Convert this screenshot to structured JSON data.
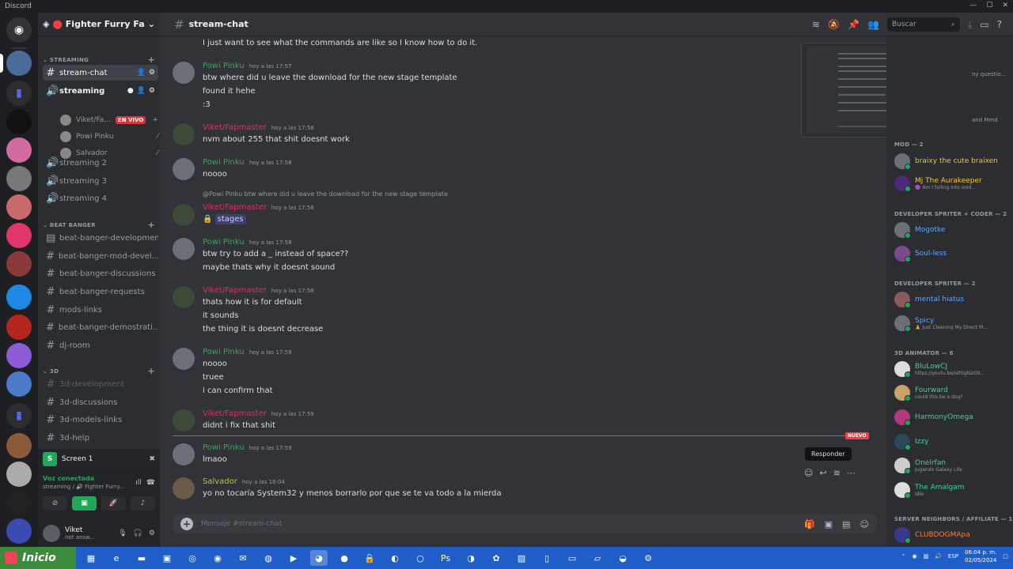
{
  "window": {
    "title": "Discord",
    "controls": [
      "—",
      "☐",
      "✕"
    ]
  },
  "server": {
    "name": "Fighter Furry Fac...",
    "chevron": "⌄"
  },
  "categories": {
    "streaming": "STREAMING",
    "beat_banger": "BEAT BANGER",
    "three_d": "3D"
  },
  "channels": {
    "stream_chat": "stream-chat",
    "streaming": "streaming",
    "streaming2": "streaming 2",
    "streaming3": "streaming 3",
    "streaming4": "streaming 4",
    "bb_dev": "beat-banger-development",
    "bb_mod": "beat-banger-mod-devel...",
    "bb_disc": "beat-banger-discussions",
    "bb_req": "beat-banger-requests",
    "mods_links": "mods-links",
    "bb_demo": "beat-banger-demostrati...",
    "dj_room": "dj-room",
    "td_dev": "3d-development",
    "td_disc": "3d-discussions",
    "td_models": "3d-models-links",
    "td_help": "3d-help"
  },
  "voice_users": [
    {
      "name": "Viket/Fa...",
      "badge": "EN VIVO"
    },
    {
      "name": "Powi Pinku"
    },
    {
      "name": "Salvador"
    }
  ],
  "screen_share": {
    "label": "Screen 1",
    "icon": "S"
  },
  "voice": {
    "status": "Voz conectada",
    "location": "streaming / 🔊 Fighter Furry..."
  },
  "user": {
    "name": "Viket",
    "status": "not answ..."
  },
  "chat": {
    "channel": "stream-chat",
    "search_placeholder": "Buscar",
    "composer_placeholder": "Mensaje #stream-chat"
  },
  "messages": {
    "m0": {
      "text": "I just want to see what the commands are like so I know how to do it."
    },
    "m1": {
      "author": "Powi Pinku",
      "time": "hoy a las 17:57",
      "lines": [
        "btw where did u leave the download for the new stage template",
        "found it hehe",
        ":3"
      ]
    },
    "m2": {
      "author": "Viket/Fapmaster",
      "time": "hoy a las 17:58",
      "lines": [
        "nvm about 255 that shit doesnt work"
      ]
    },
    "m3": {
      "author": "Powi Pinku",
      "time": "hoy a las 17:58",
      "lines": [
        "noooo"
      ]
    },
    "m4": {
      "reply": "@Powi Pinku btw where did u leave the download for the new stage template",
      "author": "Viket/Fapmaster",
      "time": "hoy a las 17:58",
      "mention": "stages"
    },
    "m5": {
      "author": "Powi Pinku",
      "time": "hoy a las 17:58",
      "lines": [
        "btw try to add a _ instead of space??",
        "maybe thats why it doesnt sound"
      ]
    },
    "m6": {
      "author": "Viket/Fapmaster",
      "time": "hoy a las 17:58",
      "lines": [
        "thats how it is for default",
        "it sounds",
        "the thing it is doesnt decrease"
      ]
    },
    "m7": {
      "author": "Powi Pinku",
      "time": "hoy a las 17:59",
      "lines": [
        "noooo",
        "truee",
        "i can confirm that"
      ]
    },
    "m8": {
      "author": "Viket/Fapmaster",
      "time": "hoy a las 17:59",
      "lines": [
        "didnt i fix that shit"
      ]
    },
    "m9": {
      "author": "Powi Pinku",
      "time": "hoy a las 17:59",
      "lines": [
        "lmaoo"
      ]
    },
    "m10": {
      "author": "Salvador",
      "time": "hoy a las 18:04",
      "lines": [
        "yo no tocaría System32 y menos borrarlo por que se te va todo a la mierda"
      ]
    }
  },
  "new_marker": "NUEVO",
  "tooltip": "Responder",
  "preview_text": {
    "a": "er",
    "b": "ny questio...",
    "c": "and Mmd"
  },
  "member_groups": {
    "mod": "MOD — 2",
    "dev_spriter_coder": "DEVELOPER SPRITER + CODER — 2",
    "dev_spriter": "DEVELOPER SPRITER — 2",
    "animator": "3D ANIMATOR — 6",
    "neighbors": "SERVER NEIGHBORS / AFFILIATE — 1"
  },
  "members": {
    "braixy": {
      "name": "braixy the cute braixen",
      "status": ""
    },
    "mj": {
      "name": "Mj The Aurakeeper",
      "status": "🟣 Am I falling into void..."
    },
    "mogotke": {
      "name": "Mogotke",
      "status": ""
    },
    "soulless": {
      "name": "Soul-less",
      "status": ""
    },
    "mental": {
      "name": "mental hiatus",
      "status": ""
    },
    "spicy": {
      "name": "Spicy",
      "status": "🙏 Just Cleaning My Direct M..."
    },
    "blulow": {
      "name": "BluLowCJ",
      "status": "https://youtu.be/IdtSgN2G9..."
    },
    "fourward": {
      "name": "Fourward",
      "status": "could this be a dog?"
    },
    "harmony": {
      "name": "HarmonyOmega",
      "status": ""
    },
    "izzy": {
      "name": "Izzy",
      "status": ""
    },
    "onelrfan": {
      "name": "Onelrfan",
      "status": "Jugando Galaxy Life"
    },
    "amalgam": {
      "name": "The Amalgam",
      "status": "Idle"
    },
    "clubdog": {
      "name": "CLUBDOGMApa",
      "status": ""
    }
  },
  "taskbar": {
    "start": "Inicio",
    "lang": "ESP",
    "time": "06:04 p. m.",
    "date": "02/05/2024"
  },
  "colors": {
    "pink": "#dd2e6e",
    "green": "#3ba55c",
    "accent": "#5865f2"
  }
}
